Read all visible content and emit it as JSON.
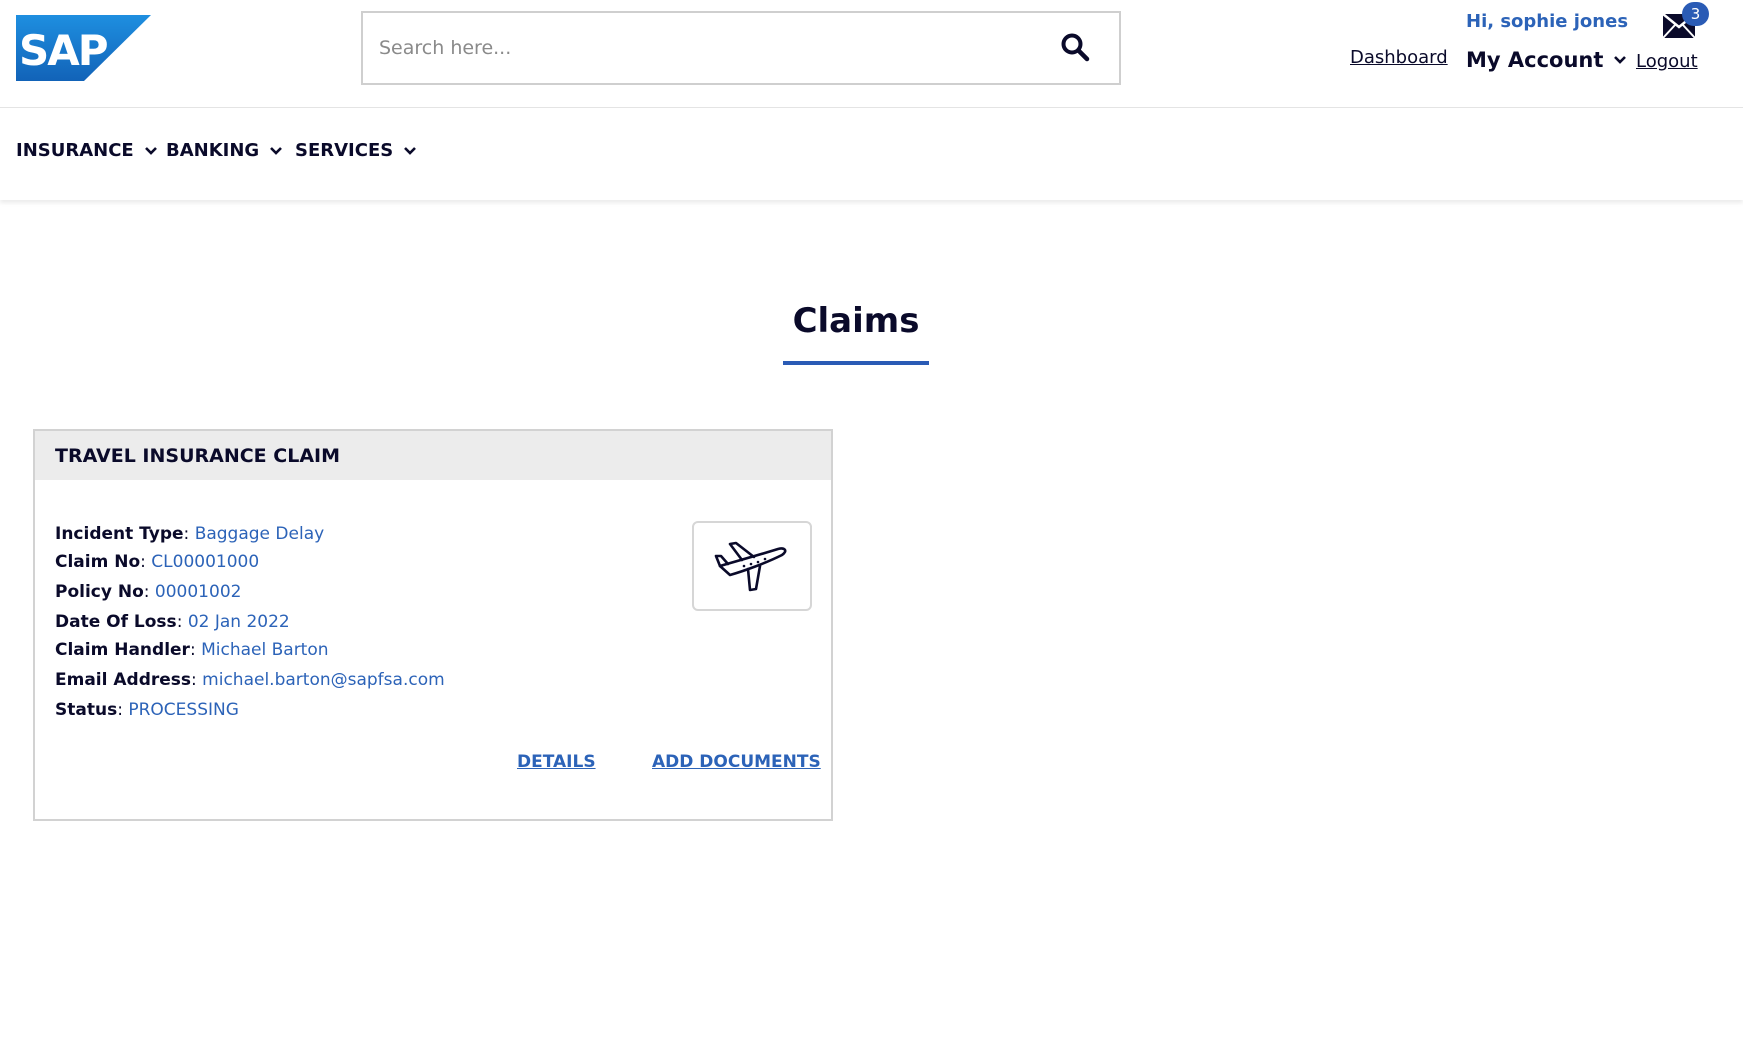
{
  "header": {
    "logo_text": "SAP",
    "search_placeholder": "Search here...",
    "search_value": "",
    "greeting": "Hi, sophie jones",
    "mail_count": "3",
    "dashboard_label": "Dashboard",
    "account_label": "My Account",
    "logout_label": "Logout"
  },
  "nav": {
    "items": [
      {
        "label": "INSURANCE",
        "icon": "chevron-down-icon"
      },
      {
        "label": "BANKING",
        "icon": "chevron-down-icon"
      },
      {
        "label": "SERVICES",
        "icon": "chevron-down-icon"
      }
    ]
  },
  "page": {
    "title": "Claims"
  },
  "claim": {
    "title": "TRAVEL INSURANCE CLAIM",
    "icon": "airplane-icon",
    "fields": [
      {
        "label": "Incident Type",
        "value": "Baggage Delay"
      },
      {
        "label": "Claim No",
        "value": "CL00001000"
      },
      {
        "label": "Policy No",
        "value": "00001002"
      },
      {
        "label": "Date Of Loss",
        "value": "02 Jan 2022"
      },
      {
        "label": "Claim Handler",
        "value": "Michael Barton"
      },
      {
        "label": "Email Address",
        "value": "michael.barton@sapfsa.com"
      },
      {
        "label": "Status",
        "value": "PROCESSING"
      }
    ],
    "details_label": "DETAILS",
    "add_documents_label": "ADD DOCUMENTS"
  },
  "colors": {
    "brand_blue": "#2a5bb5",
    "link_blue": "#2c63b8",
    "text_dark": "#0a0a2a",
    "card_header_bg": "#ececec"
  }
}
